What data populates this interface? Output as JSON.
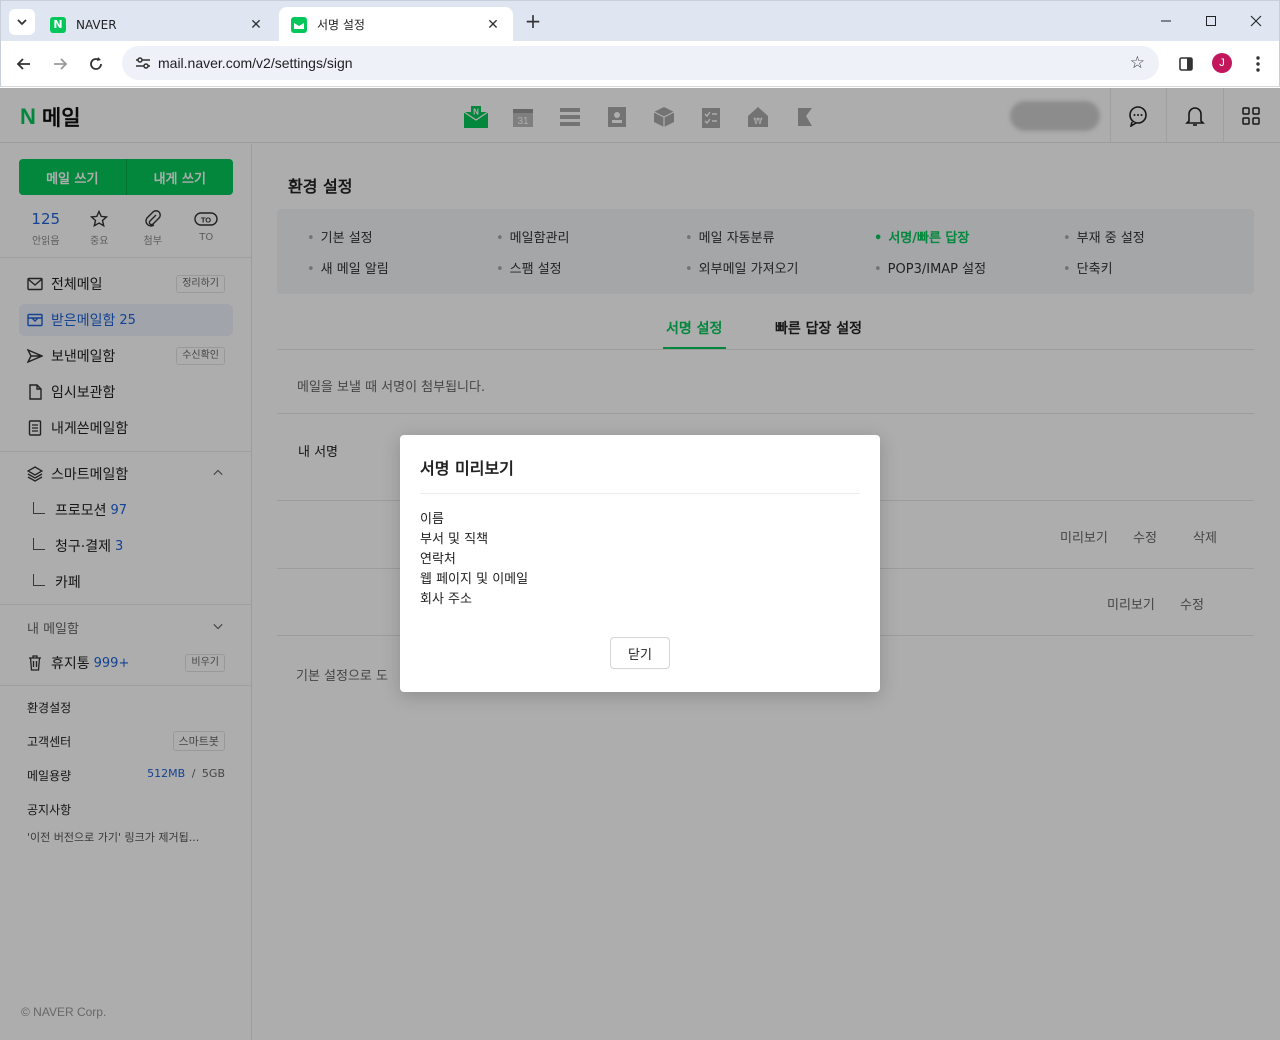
{
  "browser": {
    "tabs": [
      {
        "title": "NAVER",
        "favicon_color": "#03c75a",
        "favicon_letter": "N"
      },
      {
        "title": "서명 설정",
        "favicon_color": "#03c75a"
      }
    ],
    "url": "mail.naver.com/v2/settings/sign",
    "profile_initial": "J"
  },
  "app": {
    "logo_letter": "N",
    "logo_name": "메일",
    "services": [
      "mail-icon",
      "calendar-icon",
      "list-icon",
      "contacts-icon",
      "mybox-icon",
      "todo-icon",
      "pay-icon",
      "bookmark-icon"
    ],
    "calendar_day": "31",
    "accent": "#03c75a",
    "link_blue": "#1e63d8"
  },
  "sidebar": {
    "write_mail": "메일 쓰기",
    "write_self": "내게 쓰기",
    "quick": [
      {
        "value": "125",
        "label": "안읽음"
      },
      {
        "icon": "star-icon",
        "label": "중요"
      },
      {
        "icon": "paperclip-icon",
        "label": "첨부"
      },
      {
        "icon": "to-icon",
        "icon_text": "TO",
        "label": "TO"
      }
    ],
    "folders": [
      {
        "label": "전체메일",
        "pill": "정리하기"
      },
      {
        "label": "받은메일함",
        "count": "25"
      },
      {
        "label": "보낸메일함",
        "pill": "수신확인"
      },
      {
        "label": "임시보관함"
      },
      {
        "label": "내게쓴메일함"
      }
    ],
    "smart": {
      "label": "스마트메일함",
      "items": [
        {
          "label": "프로모션",
          "count": "97"
        },
        {
          "label": "청구·결제",
          "count": "3"
        },
        {
          "label": "카페"
        }
      ]
    },
    "my_mailbox": "내 메일함",
    "trash": {
      "label": "휴지통",
      "count": "999+",
      "pill": "비우기"
    },
    "misc": {
      "settings": "환경설정",
      "support": "고객센터",
      "support_pill": "스마트봇",
      "quota_label": "메일용량",
      "quota_used": "512MB",
      "quota_sep": "/",
      "quota_total": "5GB",
      "notice": "공지사항",
      "notice_text": "'이전 버전으로 가기' 링크가 제거됩..."
    },
    "footer": "© NAVER Corp."
  },
  "content": {
    "title": "환경 설정",
    "menu": [
      "기본 설정",
      "메일함관리",
      "메일 자동분류",
      "서명/빠른 답장",
      "부재 중 설정",
      "새 메일 알림",
      "스팸 설정",
      "외부메일 가져오기",
      "POP3/IMAP 설정",
      "단축키"
    ],
    "active_menu": "서명/빠른 답장",
    "subtabs": [
      "서명 설정",
      "빠른 답장 설정"
    ],
    "description": "메일을 보낼 때 서명이 첨부됩니다.",
    "my_signature": "내 서명",
    "row1_actions": [
      "미리보기",
      "수정",
      "삭제"
    ],
    "row2_actions": [
      "미리보기",
      "수정"
    ],
    "reset_text": "기본 설정으로 도"
  },
  "modal": {
    "title": "서명 미리보기",
    "lines": [
      "이름",
      "부서 및 직책",
      "연락처",
      "웹 페이지 및 이메일",
      "회사 주소"
    ],
    "close": "닫기"
  }
}
